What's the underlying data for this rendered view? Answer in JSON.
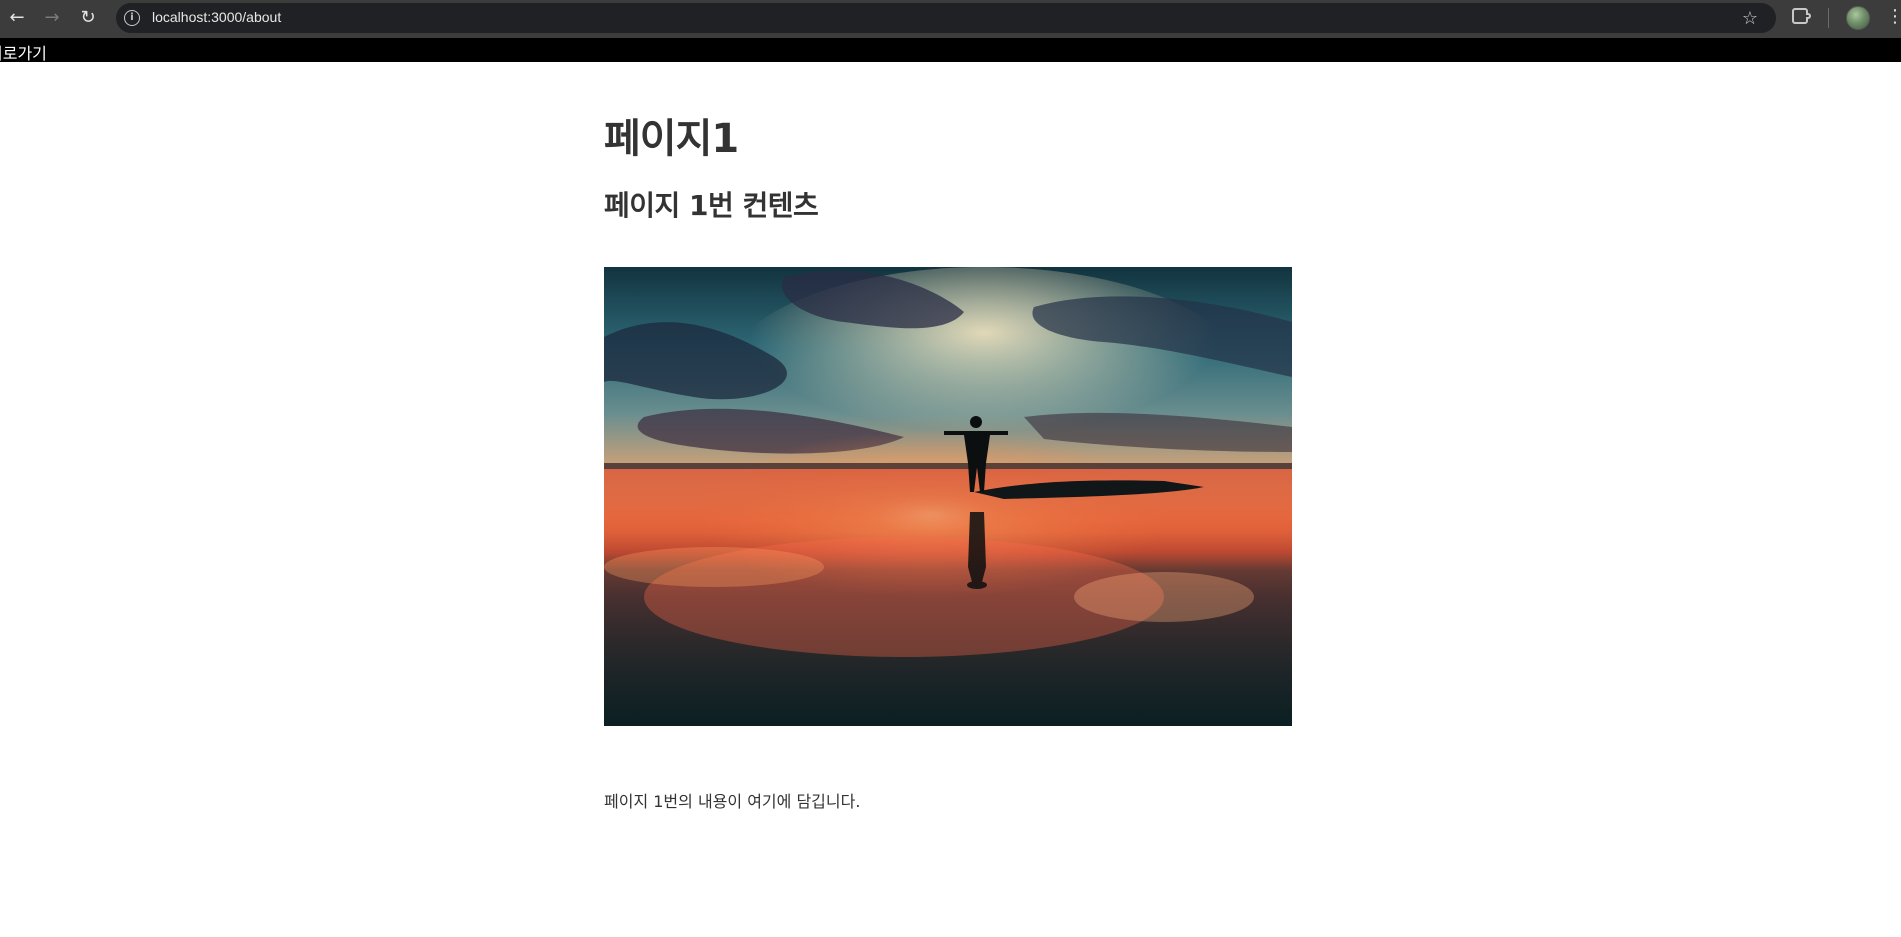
{
  "browser": {
    "url": "localhost:3000/about",
    "icons": {
      "back": "arrow-left-icon",
      "forward": "arrow-right-icon",
      "reload": "reload-icon",
      "site_info": "info-icon",
      "bookmark": "star-icon",
      "extensions": "puzzle-icon",
      "profile": "avatar",
      "menu": "kebab-menu-icon"
    }
  },
  "page": {
    "back_link": "뒤로가기",
    "title": "페이지1",
    "subtitle": "페이지 1번 컨텐츠",
    "body": "페이지 1번의 내용이 여기에 담깁니다.",
    "image_alt": "Silhouette of a person with outstretched arms at sunset on the beach"
  },
  "colors": {
    "topbar_bg": "#000000",
    "heading_text": "#333333",
    "chrome_bg": "#3c3c3c"
  }
}
